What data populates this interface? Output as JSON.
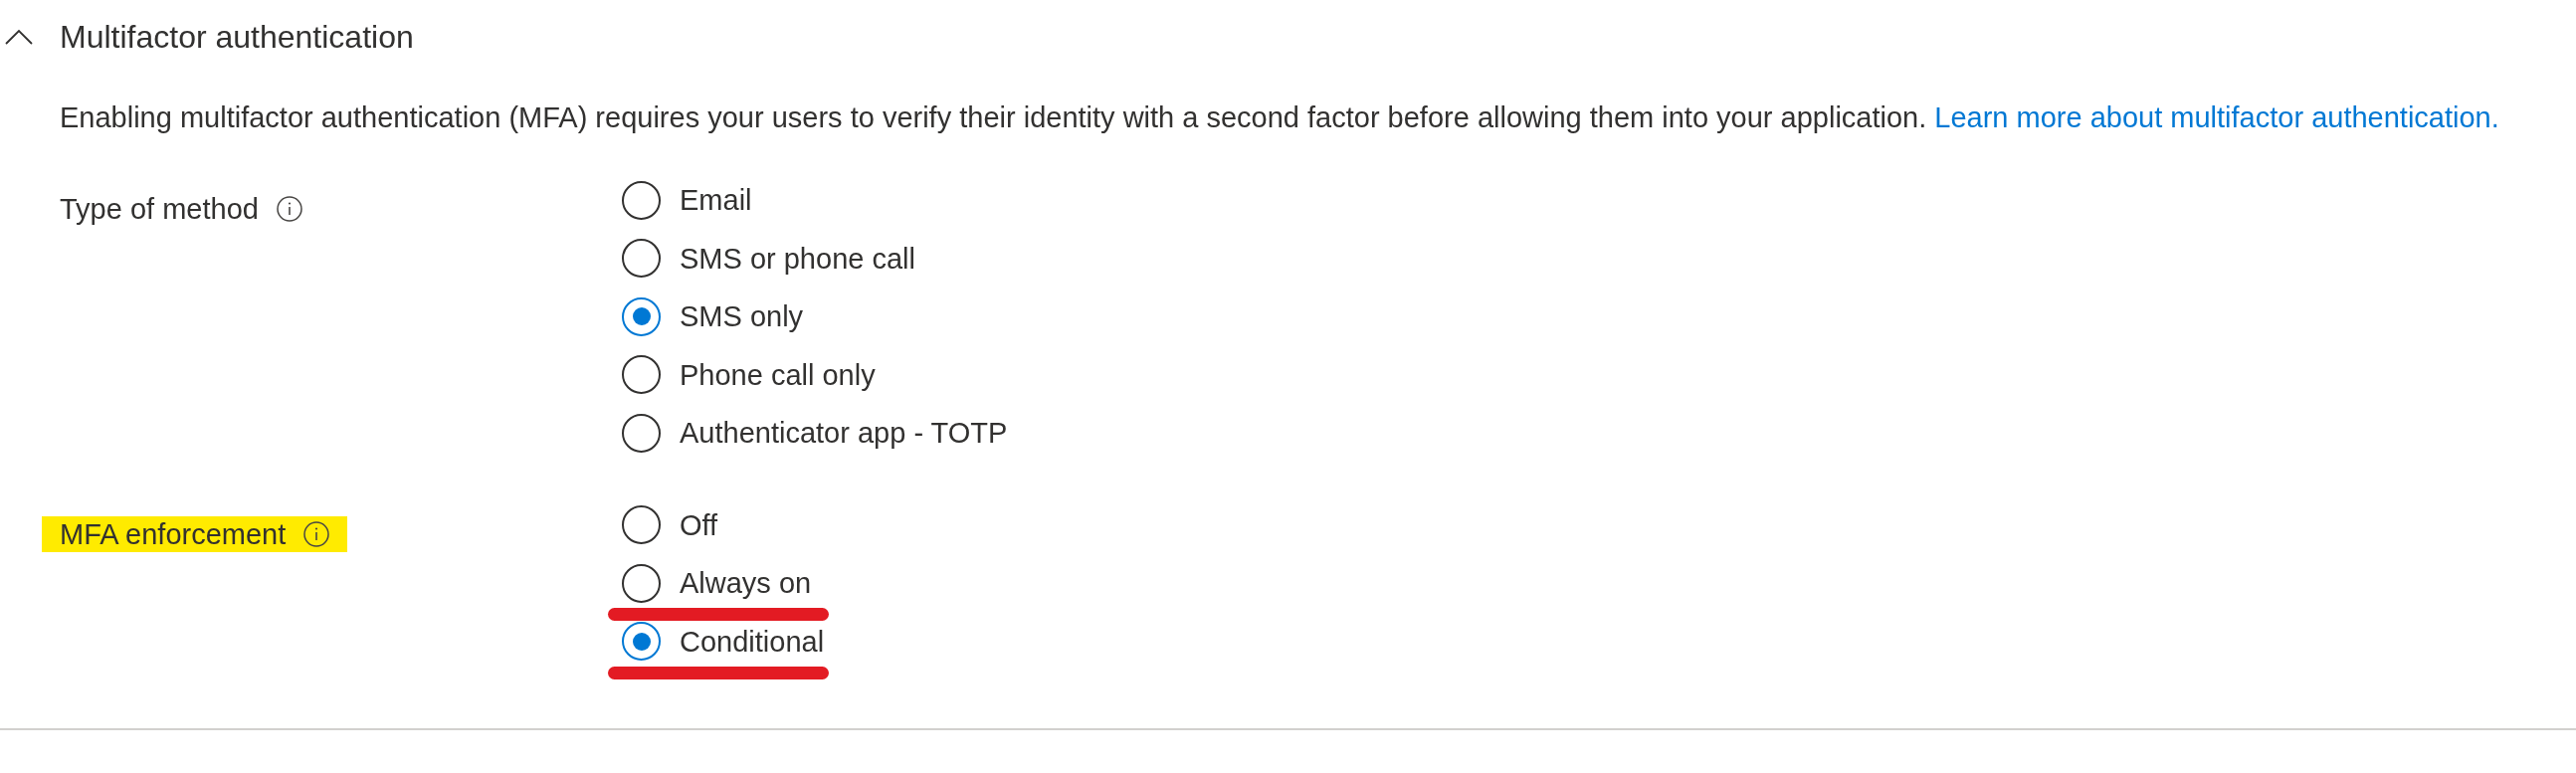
{
  "section": {
    "title": "Multifactor authentication",
    "expanded": true,
    "description": "Enabling multifactor authentication (MFA) requires your users to verify their identity with a second factor before allowing them into your application.",
    "link": "Learn more about multifactor authentication."
  },
  "fields": [
    {
      "label": "Type of method",
      "highlighted": false,
      "options": [
        {
          "label": "Email",
          "selected": false,
          "underlined": false
        },
        {
          "label": "SMS or phone call",
          "selected": false,
          "underlined": false
        },
        {
          "label": "SMS only",
          "selected": true,
          "underlined": false
        },
        {
          "label": "Phone call only",
          "selected": false,
          "underlined": false
        },
        {
          "label": "Authenticator app - TOTP",
          "selected": false,
          "underlined": false
        }
      ]
    },
    {
      "label": "MFA enforcement",
      "highlighted": true,
      "options": [
        {
          "label": "Off",
          "selected": false,
          "underlined": false
        },
        {
          "label": "Always on",
          "selected": false,
          "underlined": true
        },
        {
          "label": "Conditional",
          "selected": true,
          "underlined": true
        }
      ]
    }
  ]
}
